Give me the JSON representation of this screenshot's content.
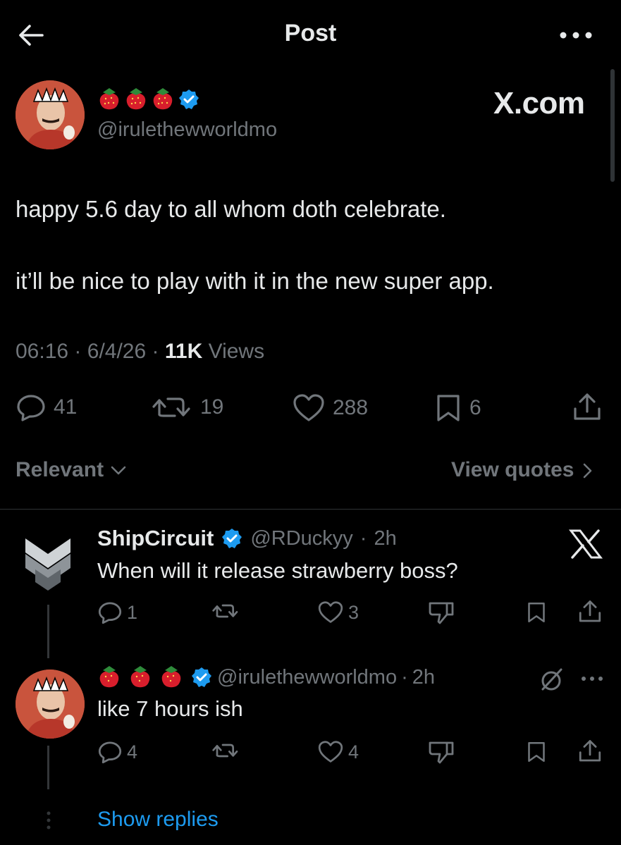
{
  "header": {
    "title": "Post"
  },
  "post": {
    "handle": "@irulethewworldmo",
    "brand_label": "X.com",
    "text_line1": "happy 5.6 day to all whom doth celebrate.",
    "text_line2": "it’ll be nice to play with it in the new super app.",
    "time": "06:16",
    "date": "6/4/26",
    "views_count": "11K",
    "views_label": "Views",
    "sep": "·",
    "actions": {
      "replies": "41",
      "reposts": "19",
      "likes": "288",
      "bookmarks": "6"
    }
  },
  "filters": {
    "sort_label": "Relevant",
    "view_quotes_label": "View quotes"
  },
  "replies": [
    {
      "name": "ShipCircuit",
      "handle": "@RDuckyy",
      "time": "2h",
      "text": "When will it release strawberry boss?",
      "actions": {
        "replies": "1",
        "reposts": "",
        "likes": "3"
      }
    },
    {
      "name": "",
      "handle": "@irulethewworldmo",
      "time": "2h",
      "text": "like 7 hours ish",
      "actions": {
        "replies": "4",
        "reposts": "",
        "likes": "4"
      }
    }
  ],
  "show_replies_label": "Show replies",
  "colors": {
    "background": "#000000",
    "text": "#e7e9ea",
    "muted": "#71767b",
    "accent": "#1d9bf0",
    "verified": "#1d9bf0"
  },
  "icons": [
    "back-arrow-icon",
    "more-icon",
    "verified-icon",
    "strawberry-icon",
    "reply-icon",
    "repost-icon",
    "like-icon",
    "bookmark-icon",
    "share-icon",
    "chevron-down-icon",
    "chevron-right-icon",
    "x-logo-icon",
    "downvote-icon",
    "grok-icon"
  ]
}
